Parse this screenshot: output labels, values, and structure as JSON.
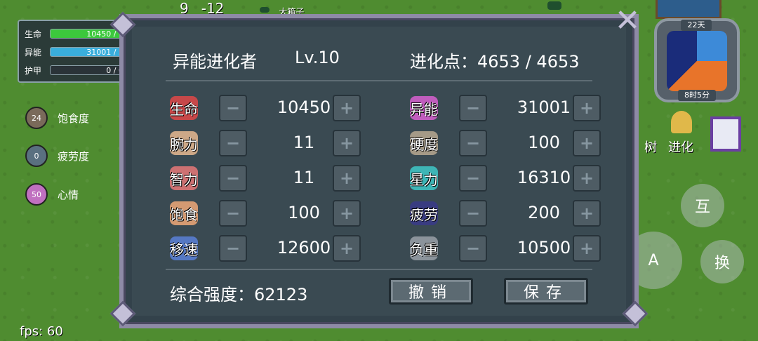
{
  "top": {
    "coord_x": "9",
    "coord_y": "-12",
    "map_label": "大箱子"
  },
  "status": [
    {
      "label": "生命",
      "value": "10450 / 1",
      "fill": 1.0,
      "color": "#3cc83c"
    },
    {
      "label": "异能",
      "value": "31001 / 3",
      "fill": 1.0,
      "color": "#3aaedc"
    },
    {
      "label": "护甲",
      "value": "0 / 0",
      "fill": 0.0,
      "color": "#3aaedc"
    }
  ],
  "needs": [
    {
      "label": "饱食度",
      "value": "24",
      "color": "#7a6a5a"
    },
    {
      "label": "疲劳度",
      "value": "0",
      "color": "#5a7080"
    },
    {
      "label": "心情",
      "value": "50",
      "color": "#c070c0"
    }
  ],
  "fps": "fps: 60",
  "clock": {
    "day": "22天",
    "time": "8时5分"
  },
  "side": {
    "tree_label": "树",
    "evolve_label": "进化"
  },
  "buttons_round": {
    "interact": "互",
    "attack": "A",
    "swap": "换"
  },
  "panel": {
    "class_name": "异能进化者",
    "level": "Lv.10",
    "points_label": "进化点：",
    "points_value": "4653 / 4653",
    "attributes_left": [
      {
        "name": "生命",
        "value": "10450",
        "icon": "heart-icon",
        "color": "#e04848"
      },
      {
        "name": "腕力",
        "value": "11",
        "icon": "fist-icon",
        "color": "#e8b890"
      },
      {
        "name": "智力",
        "value": "11",
        "icon": "brain-icon",
        "color": "#e87878"
      },
      {
        "name": "饱食",
        "value": "100",
        "icon": "meat-icon",
        "color": "#f0a878"
      },
      {
        "name": "移速",
        "value": "12600",
        "icon": "wing-icon",
        "color": "#5a80d8"
      }
    ],
    "attributes_right": [
      {
        "name": "异能",
        "value": "31001",
        "icon": "star-icon",
        "color": "#d860d0"
      },
      {
        "name": "硬度",
        "value": "100",
        "icon": "armor-icon",
        "color": "#b8a890"
      },
      {
        "name": "星力",
        "value": "16310",
        "icon": "crystal-icon",
        "color": "#40c8c8"
      },
      {
        "name": "疲劳",
        "value": "200",
        "icon": "bat-icon",
        "color": "#3a3a8a"
      },
      {
        "name": "负重",
        "value": "10500",
        "icon": "weight-icon",
        "color": "#9aa0a8"
      }
    ],
    "minus": "−",
    "plus": "+",
    "total_label": "综合强度：",
    "total_value": "62123",
    "undo_label": "撤销",
    "save_label": "保存"
  }
}
